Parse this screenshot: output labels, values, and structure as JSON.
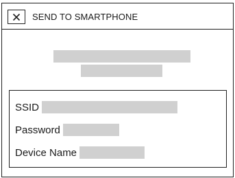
{
  "dialog": {
    "title": "SEND TO SMARTPHONE",
    "close_icon": "close-x-icon"
  },
  "message": {
    "lines_redacted": 2
  },
  "info": {
    "fields": [
      {
        "label": "SSID",
        "value": ""
      },
      {
        "label": "Password",
        "value": ""
      },
      {
        "label": "Device Name",
        "value": ""
      }
    ]
  },
  "colors": {
    "border": "#1f1f1f",
    "redaction": "#d0d0d0",
    "background": "#ffffff",
    "text": "#1a1a1a"
  }
}
